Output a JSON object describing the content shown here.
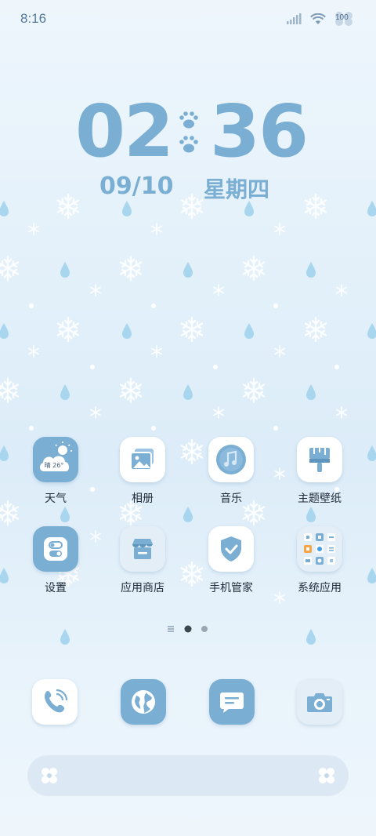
{
  "status_bar": {
    "time": "8:16",
    "battery": "100"
  },
  "clock": {
    "hours": "02",
    "minutes": "36",
    "date": "09/10",
    "weekday": "星期四"
  },
  "apps": [
    {
      "label": "天气",
      "weather_text": "晴 26°"
    },
    {
      "label": "相册"
    },
    {
      "label": "音乐"
    },
    {
      "label": "主题壁纸"
    },
    {
      "label": "设置"
    },
    {
      "label": "应用商店"
    },
    {
      "label": "手机管家"
    },
    {
      "label": "系统应用"
    }
  ],
  "pager": {
    "pages": 2,
    "current": 1
  },
  "dock": [
    "phone-icon",
    "browser-icon",
    "messages-icon",
    "camera-icon"
  ],
  "colors": {
    "accent": "#7aaed3",
    "background": "#e2f0fa",
    "text": "#1f2b36"
  }
}
